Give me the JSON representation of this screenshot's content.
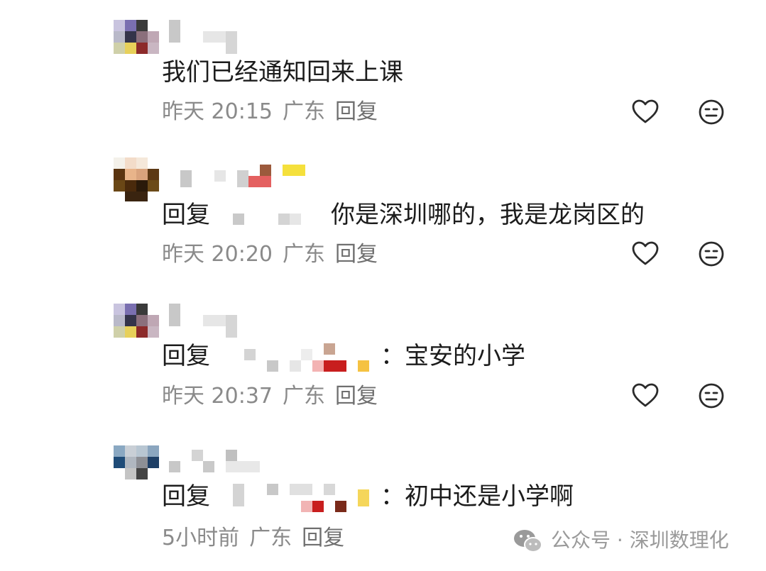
{
  "comments": [
    {
      "text": "我们已经通知回来上课",
      "time": "昨天 20:15",
      "location": "广东",
      "reply_label": "回复"
    },
    {
      "reply_prefix": "回复",
      "text": "你是深圳哪的，我是龙岗区的",
      "time": "昨天 20:20",
      "location": "广东",
      "reply_label": "回复"
    },
    {
      "reply_prefix": "回复",
      "separator": "：",
      "text": "宝安的小学",
      "time": "昨天 20:37",
      "location": "广东",
      "reply_label": "回复"
    },
    {
      "reply_prefix": "回复",
      "separator": "：",
      "text": "初中还是小学啊",
      "time": "5小时前",
      "location": "广东",
      "reply_label": "回复"
    }
  ],
  "watermark": {
    "text": "公众号 · 深圳数理化"
  },
  "icons": {
    "like": "heart-outline-icon",
    "dislike": "neutral-face-icon",
    "wechat": "wechat-logo-icon"
  },
  "colors": {
    "text": "#1c1c1c",
    "meta": "#8a8a8a",
    "icon": "#2a2a2a"
  }
}
